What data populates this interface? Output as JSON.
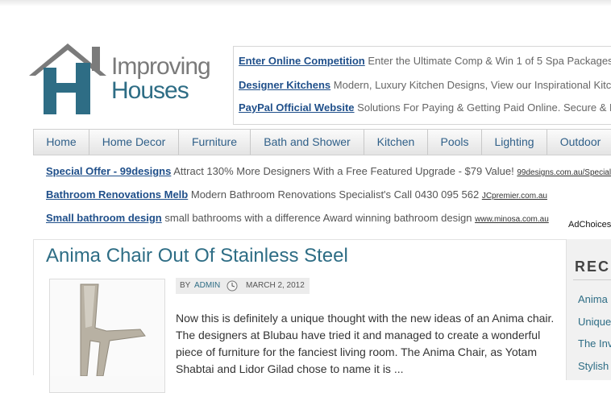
{
  "brand": {
    "line1": "Improving",
    "line2": "Houses",
    "colors": {
      "primary": "#2e6d85",
      "gray": "#6f6f6f"
    }
  },
  "top_ads": [
    {
      "title": "Enter Online Competition",
      "desc": "Enter the Ultimate Comp & Win 1 of 5 Spa Packages"
    },
    {
      "title": "Designer Kitchens",
      "desc": "Modern, Luxury Kitchen Designs, View our Inspirational Kitchens"
    },
    {
      "title": "PayPal Official Website",
      "desc": "Solutions For Paying & Getting Paid Online. Secure & Easy"
    }
  ],
  "nav": [
    "Home",
    "Home Decor",
    "Furniture",
    "Bath and Shower",
    "Kitchen",
    "Pools",
    "Lighting",
    "Outdoor"
  ],
  "link_ads": [
    {
      "title": "Special Offer - 99designs",
      "desc": "Attract 130% More Designers With a Free Featured Upgrade - $79 Value!",
      "url": "99designs.com.au/Special"
    },
    {
      "title": "Bathroom Renovations Melb",
      "desc": "Modern Bathroom Renovations Specialist's Call 0430 095 562",
      "url": "JCpremier.com.au"
    },
    {
      "title": "Small bathroom design",
      "desc": "small bathrooms with a difference Award winning bathroom design",
      "url": "www.minosa.com.au"
    }
  ],
  "adchoices": "AdChoices",
  "post": {
    "title": "Anima Chair Out Of Stainless Steel",
    "by": "BY",
    "author": "ADMIN",
    "date": "MARCH 2, 2012",
    "excerpt": "Now this is definitely a unique thought with the new ideas of an Anima chair. The designers at Blubau have tried it and managed to create a wonderful piece of furniture for the fanciest living room. The Anima Chair, as Yotam Shabtai and Lidor Gilad chose to name it is ..."
  },
  "sidebar": {
    "heading": "RECE",
    "items": [
      "Anima C",
      "Unique",
      "The Invi",
      "Stylish"
    ]
  }
}
